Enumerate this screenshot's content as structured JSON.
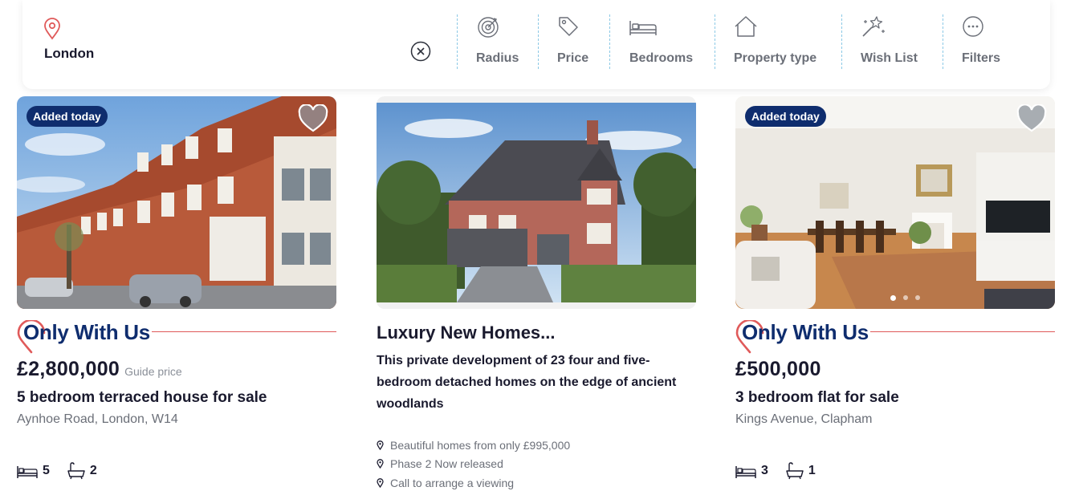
{
  "search": {
    "location": "London",
    "filters": [
      {
        "label": "Radius",
        "icon": "radius-target-icon"
      },
      {
        "label": "Price",
        "icon": "price-tag-icon"
      },
      {
        "label": "Bedrooms",
        "icon": "bed-icon"
      },
      {
        "label": "Property type",
        "icon": "house-icon"
      },
      {
        "label": "Wish List",
        "icon": "magic-wand-icon"
      },
      {
        "label": "Filters",
        "icon": "more-dots-icon"
      }
    ]
  },
  "listings": [
    {
      "badge": "Added today",
      "tag": "Only With Us",
      "price": "£2,800,000",
      "price_qualifier": "Guide price",
      "title": "5 bedroom terraced house for sale",
      "address": "Aynhoe Road, London, W14",
      "bedrooms": "5",
      "bathrooms": "2"
    },
    {
      "title": "Luxury New Homes...",
      "description": "This private development of 23 four and five-bedroom detached homes on the edge of ancient woodlands",
      "bullets": [
        "Beautiful homes from only £995,000",
        "Phase 2 Now released",
        "Call to arrange a viewing"
      ]
    },
    {
      "badge": "Added today",
      "tag": "Only With Us",
      "price": "£500,000",
      "title": "3 bedroom flat for sale",
      "address": "Kings Avenue, Clapham",
      "bedrooms": "3",
      "bathrooms": "1"
    }
  ],
  "colors": {
    "brand_navy": "#0f2d6e",
    "accent_red": "#e05a5a",
    "divider_blue": "#8cc9e6"
  }
}
